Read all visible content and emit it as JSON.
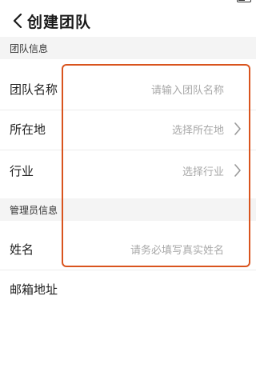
{
  "nav": {
    "title": "创建团队"
  },
  "sections": {
    "team_info": "团队信息",
    "admin_info": "管理员信息"
  },
  "team_rows": {
    "name": {
      "label": "团队名称",
      "placeholder": "请输入团队名称"
    },
    "location": {
      "label": "所在地",
      "placeholder": "选择所在地"
    },
    "industry": {
      "label": "行业",
      "placeholder": "选择行业"
    }
  },
  "admin_rows": {
    "person_name": {
      "label": "姓名",
      "placeholder": "请务必填写真实姓名"
    },
    "email": {
      "label": "邮箱地址",
      "placeholder": ""
    }
  },
  "colors": {
    "highlight": "#d9541e",
    "section_bg": "#f4f4f4",
    "placeholder": "#a8a8a8"
  },
  "icons": {
    "back": "chevron-left-icon",
    "row_arrow": "chevron-right-icon"
  }
}
